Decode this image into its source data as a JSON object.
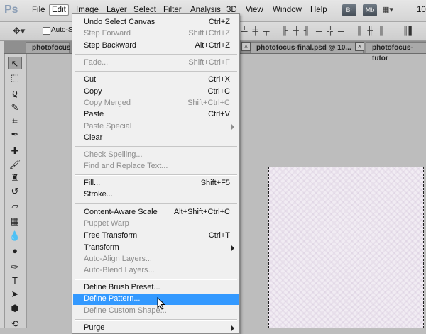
{
  "app": {
    "logo": "Ps"
  },
  "menubar": {
    "items": [
      "File",
      "Edit",
      "Image",
      "Layer",
      "Select",
      "Filter",
      "Analysis",
      "3D",
      "View",
      "Window",
      "Help"
    ],
    "bridge_badge": "Br",
    "minibridge_badge": "Mb",
    "zoom_partial": "10"
  },
  "options": {
    "auto_select_label": "Auto-S"
  },
  "tabs": [
    {
      "label": "photofocus"
    },
    {
      "label": "photofocus-final.psd @ 10..."
    },
    {
      "label": "photofocus-tutor"
    }
  ],
  "edit_menu": {
    "items": [
      {
        "label": "Undo Select Canvas",
        "shortcut": "Ctrl+Z",
        "enabled": true
      },
      {
        "label": "Step Forward",
        "shortcut": "Shift+Ctrl+Z",
        "enabled": false
      },
      {
        "label": "Step Backward",
        "shortcut": "Alt+Ctrl+Z",
        "enabled": true
      },
      {
        "label": "Fade...",
        "shortcut": "Shift+Ctrl+F",
        "enabled": false
      },
      {
        "label": "Cut",
        "shortcut": "Ctrl+X",
        "enabled": true
      },
      {
        "label": "Copy",
        "shortcut": "Ctrl+C",
        "enabled": true
      },
      {
        "label": "Copy Merged",
        "shortcut": "Shift+Ctrl+C",
        "enabled": false
      },
      {
        "label": "Paste",
        "shortcut": "Ctrl+V",
        "enabled": true
      },
      {
        "label": "Paste Special",
        "shortcut": "",
        "enabled": false,
        "submenu": true
      },
      {
        "label": "Clear",
        "shortcut": "",
        "enabled": true
      },
      {
        "label": "Check Spelling...",
        "shortcut": "",
        "enabled": false
      },
      {
        "label": "Find and Replace Text...",
        "shortcut": "",
        "enabled": false
      },
      {
        "label": "Fill...",
        "shortcut": "Shift+F5",
        "enabled": true
      },
      {
        "label": "Stroke...",
        "shortcut": "",
        "enabled": true
      },
      {
        "label": "Content-Aware Scale",
        "shortcut": "Alt+Shift+Ctrl+C",
        "enabled": true
      },
      {
        "label": "Puppet Warp",
        "shortcut": "",
        "enabled": false
      },
      {
        "label": "Free Transform",
        "shortcut": "Ctrl+T",
        "enabled": true
      },
      {
        "label": "Transform",
        "shortcut": "",
        "enabled": true,
        "submenu": true
      },
      {
        "label": "Auto-Align Layers...",
        "shortcut": "",
        "enabled": false
      },
      {
        "label": "Auto-Blend Layers...",
        "shortcut": "",
        "enabled": false
      },
      {
        "label": "Define Brush Preset...",
        "shortcut": "",
        "enabled": true
      },
      {
        "label": "Define Pattern...",
        "shortcut": "",
        "enabled": true,
        "highlighted": true
      },
      {
        "label": "Define Custom Shape...",
        "shortcut": "",
        "enabled": false
      },
      {
        "label": "Purge",
        "shortcut": "",
        "enabled": true,
        "submenu": true
      }
    ]
  },
  "tools": [
    "move-tool",
    "marquee-tool",
    "lasso-tool",
    "quick-selection-tool",
    "crop-tool",
    "eyedropper-tool",
    "healing-brush-tool",
    "brush-tool",
    "clone-stamp-tool",
    "history-brush-tool",
    "eraser-tool",
    "gradient-tool",
    "blur-tool",
    "dodge-tool",
    "pen-tool",
    "type-tool",
    "path-selection-tool",
    "shape-tool",
    "3d-rotate-tool"
  ],
  "colors": {
    "highlight": "#3399ff",
    "menu_bg": "#f0f0f0",
    "workspace": "#bdbdbd"
  }
}
